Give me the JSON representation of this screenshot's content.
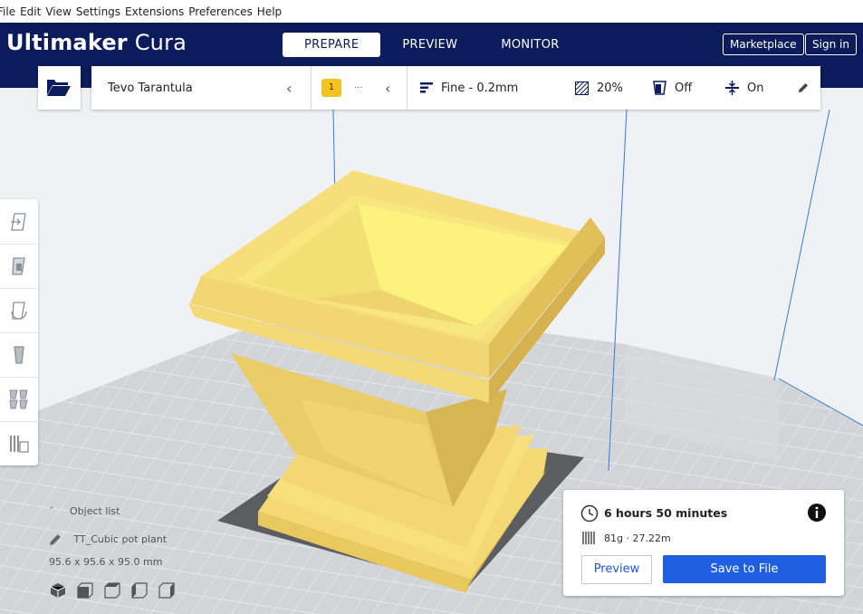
{
  "menu": [
    "File",
    "Edit",
    "View",
    "Settings",
    "Extensions",
    "Preferences",
    "Help"
  ],
  "brand": {
    "bold": "Ultimaker",
    "light": "Cura"
  },
  "stages": [
    {
      "label": "PREPARE",
      "active": true
    },
    {
      "label": "PREVIEW",
      "active": false
    },
    {
      "label": "MONITOR",
      "active": false
    }
  ],
  "header": {
    "marketplace": "Marketplace",
    "signin": "Sign in"
  },
  "printer": {
    "name": "Tevo Tarantula",
    "extruder_badge": "1",
    "extruder_more": "···"
  },
  "settings": {
    "profile": "Fine - 0.2mm",
    "infill": "20%",
    "support": "Off",
    "adhesion": "On"
  },
  "objects": {
    "list_label": "Object list",
    "name": "TT_Cubic pot plant",
    "dimensions": "95.6 x 95.6 x 95.0 mm"
  },
  "action": {
    "time": "6 hours 50 minutes",
    "material": "81g · 27.22m",
    "preview": "Preview",
    "save": "Save to File"
  },
  "colors": {
    "header": "#0c1b5b",
    "accent": "#1f5ee0",
    "model": "#f5dc6e"
  }
}
